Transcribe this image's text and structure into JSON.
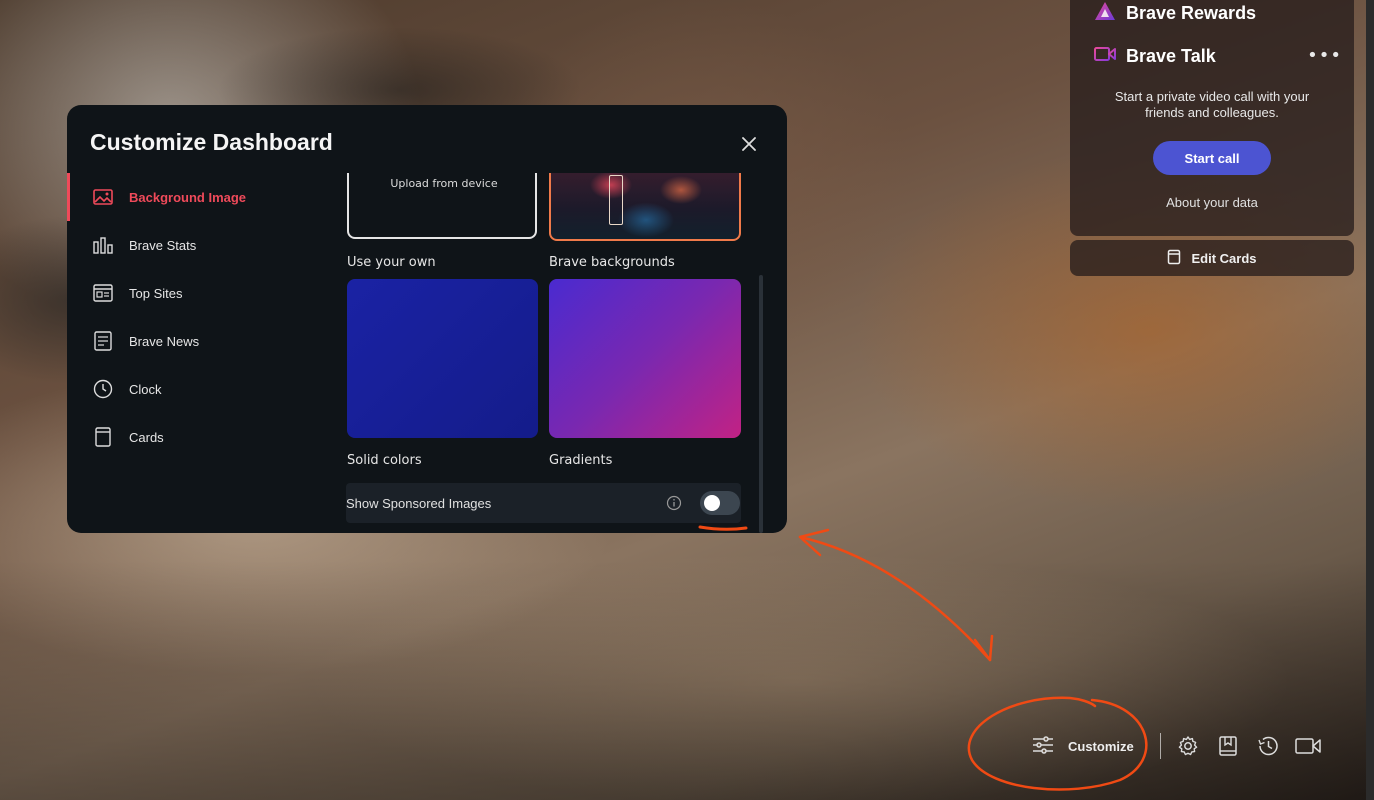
{
  "widgets": {
    "rewards": {
      "title": "Brave Rewards",
      "icon": "brave-rewards-triangle-icon"
    },
    "talk": {
      "title": "Brave Talk",
      "icon": "video-camera-icon",
      "description": "Start a private video call with your friends and colleagues.",
      "start_call_label": "Start call",
      "about_data_label": "About your data",
      "menu_icon": "more-dots-icon"
    },
    "edit_cards_label": "Edit Cards"
  },
  "modal": {
    "title": "Customize Dashboard",
    "close_icon": "close-icon",
    "nav": [
      {
        "label": "Background Image",
        "icon": "image-icon",
        "active": true
      },
      {
        "label": "Brave Stats",
        "icon": "bar-chart-icon"
      },
      {
        "label": "Top Sites",
        "icon": "top-sites-icon"
      },
      {
        "label": "Brave News",
        "icon": "news-icon"
      },
      {
        "label": "Clock",
        "icon": "clock-icon"
      },
      {
        "label": "Cards",
        "icon": "cards-icon"
      }
    ],
    "backgrounds": {
      "upload_text": "Upload from device",
      "own_label": "Use your own",
      "brave_label": "Brave backgrounds",
      "solid_label": "Solid colors",
      "gradient_label": "Gradients"
    },
    "sponsored": {
      "label": "Show Sponsored Images",
      "enabled": false
    }
  },
  "toolbar": {
    "customize_label": "Customize",
    "icons": [
      "settings-gear-icon",
      "bookmarks-icon",
      "history-icon",
      "brave-talk-icon"
    ]
  },
  "colors": {
    "accent_red": "#ef4a5a",
    "talk_button": "#4c54d2",
    "annotation": "#f04a14"
  }
}
